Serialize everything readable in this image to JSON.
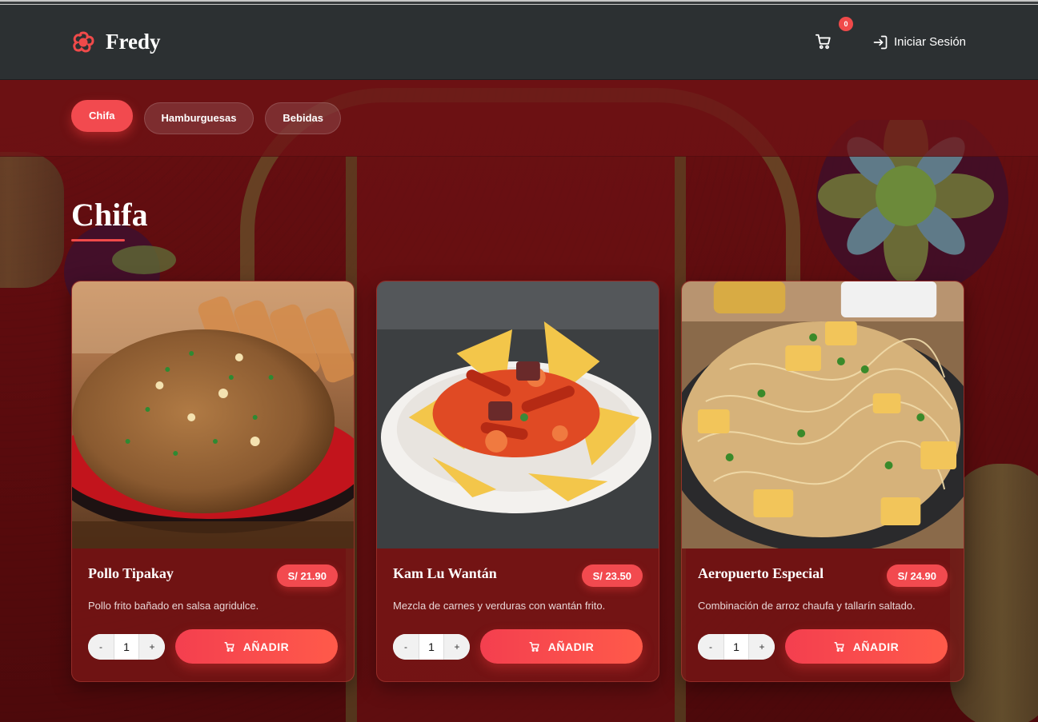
{
  "brand": {
    "name": "Fredy",
    "icon": "flower-logo-icon"
  },
  "header": {
    "cart_count": "0",
    "login_label": "Iniciar Sesión"
  },
  "categories": [
    {
      "label": "Chifa",
      "active": true
    },
    {
      "label": "Hamburguesas",
      "active": false
    },
    {
      "label": "Bebidas",
      "active": false
    }
  ],
  "section": {
    "title": "Chifa"
  },
  "products": [
    {
      "name": "Pollo Tipakay",
      "price": "S/ 21.90",
      "description": "Pollo frito bañado en salsa agridulce.",
      "quantity": "1",
      "minus": "-",
      "plus": "+",
      "add_label": "AÑADIR"
    },
    {
      "name": "Kam Lu Wantán",
      "price": "S/ 23.50",
      "description": "Mezcla de carnes y verduras con wantán frito.",
      "quantity": "1",
      "minus": "-",
      "plus": "+",
      "add_label": "AÑADIR"
    },
    {
      "name": "Aeropuerto Especial",
      "price": "S/ 24.90",
      "description": "Combinación de arroz chaufa y tallarín saltado.",
      "quantity": "1",
      "minus": "-",
      "plus": "+",
      "add_label": "AÑADIR"
    }
  ],
  "colors": {
    "accent": "#f24a4f",
    "header_bg": "#2c3032",
    "page_bg": "#5e0c0e"
  }
}
